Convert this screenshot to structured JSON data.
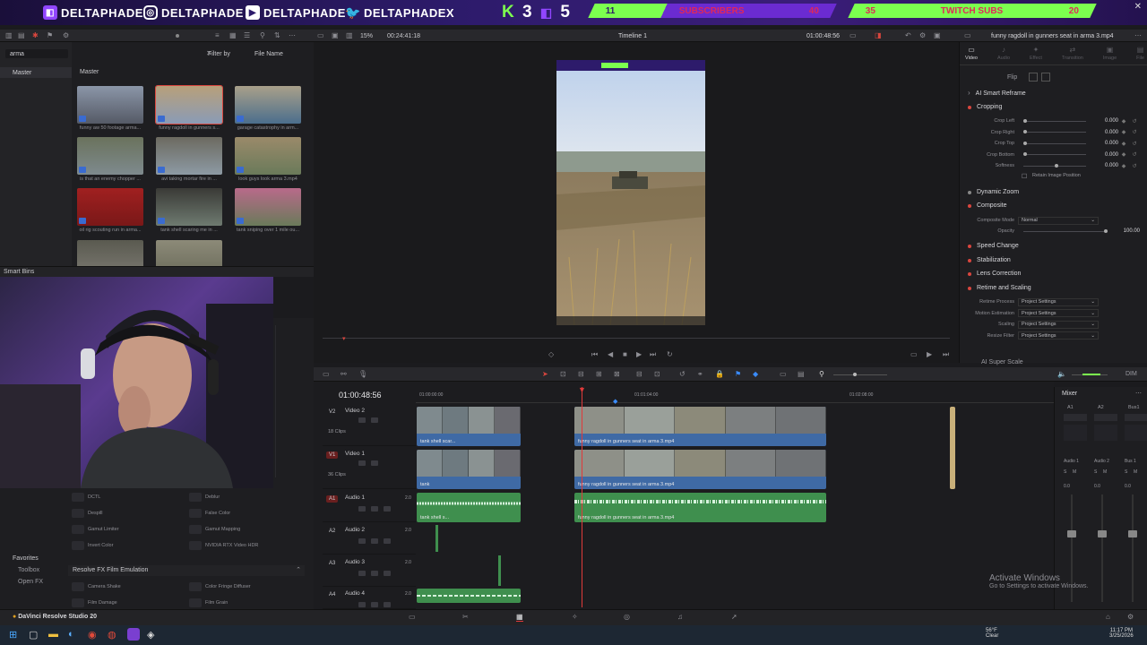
{
  "banner": {
    "socials": [
      {
        "icon": "twitch-icon",
        "handle": "DELTAPHADE"
      },
      {
        "icon": "instagram-icon",
        "handle": "DELTAPHADE"
      },
      {
        "icon": "youtube-icon",
        "handle": "DELTAPHADE"
      },
      {
        "icon": "twitter-icon",
        "handle": "DELTAPHADEX"
      }
    ],
    "counter_k": "K",
    "counter_3": "3",
    "counter_5": "5",
    "goals": [
      {
        "current": "11",
        "label": "SUBSCRIBERS",
        "target": "40"
      },
      {
        "current": "35",
        "label": "TWITCH SUBS",
        "target": "20"
      }
    ],
    "colors": {
      "accent_green": "#7CFF4F",
      "goal_red": "#e0285a"
    }
  },
  "media_pool": {
    "zoom": "15%",
    "timecode": "00:24:41:18",
    "search_value": "arma",
    "filter_label": "Filter by",
    "filter_value": "File Name",
    "tree_master": "Master",
    "pool_master": "Master",
    "smart_bins": "Smart Bins",
    "clips": [
      {
        "name": "funny aw 50 footage arma...",
        "selected": false
      },
      {
        "name": "funny ragdoll in gunners s...",
        "selected": true
      },
      {
        "name": "garage catastrophy in arm...",
        "selected": false
      },
      {
        "name": "is that an enemy chopper ...",
        "selected": false
      },
      {
        "name": "avi taking mortar fire in ...",
        "selected": false
      },
      {
        "name": "look guys look arma 3.mp4",
        "selected": false
      },
      {
        "name": "oil rig scouting run in arma...",
        "selected": false
      },
      {
        "name": "tank shell scaring me in ...",
        "selected": false
      },
      {
        "name": "tank sniping over 1 mile ou...",
        "selected": false
      },
      {
        "name": "",
        "selected": false
      },
      {
        "name": "",
        "selected": false
      }
    ]
  },
  "viewer": {
    "timeline_name": "Timeline 1",
    "timecode": "01:00:48:56"
  },
  "effects": {
    "items": [
      [
        "DCTL",
        "Deblur"
      ],
      [
        "Despill",
        "False Color"
      ],
      [
        "Gamut Limiter",
        "Gamut Mapping"
      ],
      [
        "Invert Color",
        "NVIDIA RTX Video HDR"
      ]
    ],
    "section": "Resolve FX Film Emulation",
    "items2": [
      [
        "Camera Shake",
        "Color Fringe Diffuser"
      ],
      [
        "Film Damage",
        "Film Grain"
      ]
    ],
    "favorites": "Favorites",
    "fav_items": [
      "Toolbox",
      "Open FX"
    ]
  },
  "inspector": {
    "title": "funny ragdoll in gunners seat in arma 3.mp4",
    "tabs": [
      "Video",
      "Audio",
      "Effect",
      "Transition",
      "Image",
      "File"
    ],
    "flip": "Flip",
    "ai_reframe": "AI Smart Reframe",
    "cropping": "Cropping",
    "crop_rows": [
      {
        "label": "Crop Left",
        "value": "0.000"
      },
      {
        "label": "Crop Right",
        "value": "0.000"
      },
      {
        "label": "Crop Top",
        "value": "0.000"
      },
      {
        "label": "Crop Bottom",
        "value": "0.000"
      },
      {
        "label": "Softness",
        "value": "0.000"
      }
    ],
    "retain": "Retain Image Position",
    "dynamic_zoom": "Dynamic Zoom",
    "composite": "Composite",
    "composite_mode_label": "Composite Mode",
    "composite_mode": "Normal",
    "opacity_label": "Opacity",
    "opacity": "100.00",
    "speed_change": "Speed Change",
    "stabilization": "Stabilization",
    "lens_correction": "Lens Correction",
    "retime": "Retime and Scaling",
    "retime_rows": [
      {
        "label": "Retime Process",
        "value": "Project Settings"
      },
      {
        "label": "Motion Estimation",
        "value": "Project Settings"
      },
      {
        "label": "Scaling",
        "value": "Project Settings"
      },
      {
        "label": "Resize Filter",
        "value": "Project Settings"
      }
    ],
    "ai_super_scale": "AI Super Scale"
  },
  "timeline": {
    "timecode": "01:00:48:56",
    "ruler": [
      "01:00:00:00",
      "01:01:04:00",
      "01:02:08:00"
    ],
    "tracks": [
      {
        "id": "V2",
        "name": "Video 2",
        "info": "18 Clips"
      },
      {
        "id": "V1",
        "name": "Video 1",
        "info": "36 Clips"
      },
      {
        "id": "A1",
        "name": "Audio 1",
        "info": "2.0"
      },
      {
        "id": "A2",
        "name": "Audio 2",
        "info": "2.0"
      },
      {
        "id": "A3",
        "name": "Audio 3",
        "info": "2.0"
      },
      {
        "id": "A4",
        "name": "Audio 4",
        "info": "2.0"
      }
    ],
    "clip_main": "funny ragdoll in gunners seat in arma 3.mp4",
    "clip_small": "tank shell scar...",
    "clip_small2": "tank",
    "clip_small3": "tank shell s..."
  },
  "mixer": {
    "title": "Mixer",
    "channels": [
      "A1",
      "A2",
      "Bus1"
    ],
    "labels": [
      "Audio 1",
      "Audio 2",
      "Bus 1"
    ],
    "levels": [
      "0.0",
      "0.0",
      "0.0"
    ]
  },
  "watermark": {
    "line1": "Activate Windows",
    "line2": "Go to Settings to activate Windows."
  },
  "app_label": "DaVinci Resolve Studio 20",
  "taskbar": {
    "weather": "56°F",
    "weather_desc": "Clear",
    "time": "11:17 PM",
    "date": "3/25/2026"
  },
  "dim_label": "DIM"
}
